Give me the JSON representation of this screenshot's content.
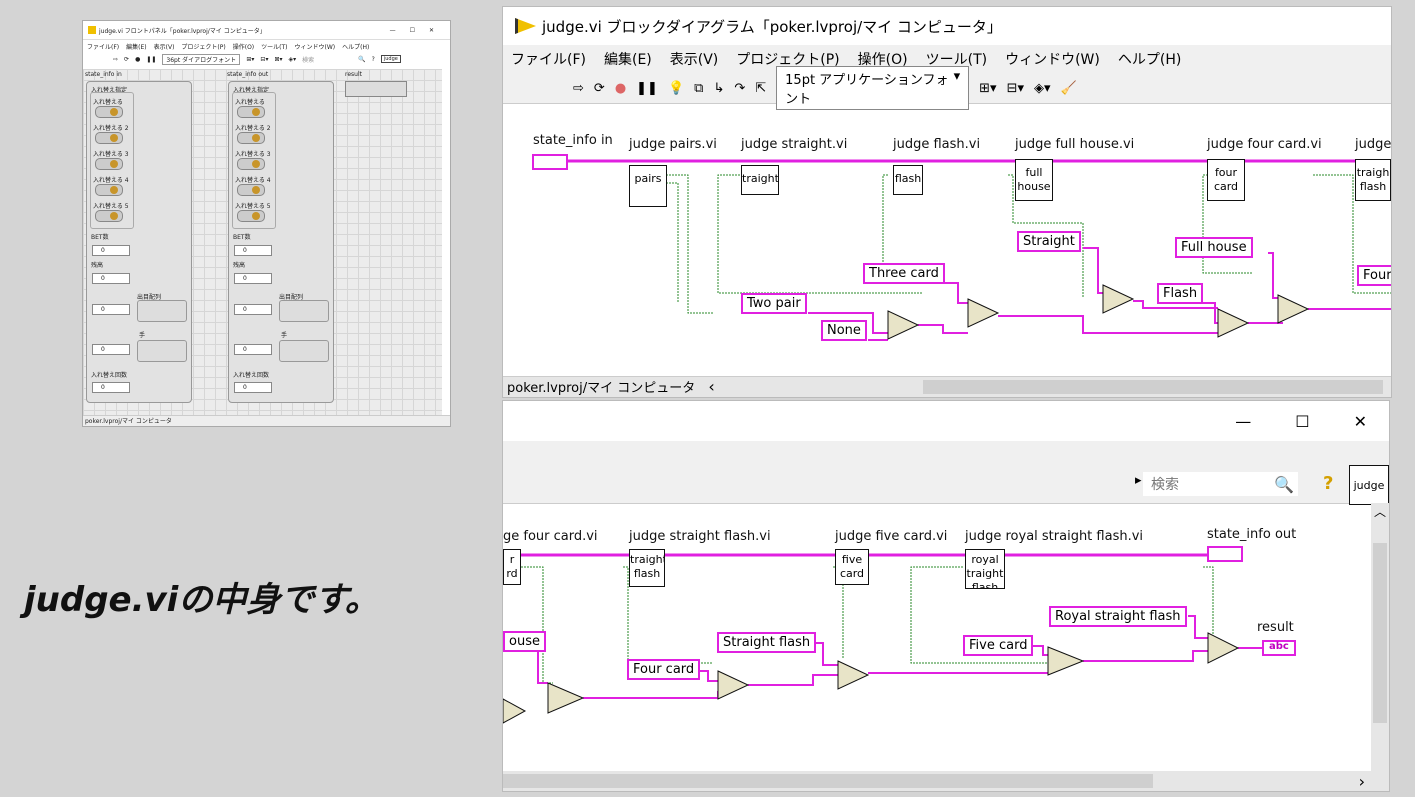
{
  "caption": "judge.viの中身です。",
  "front_panel": {
    "title": "judge.vi フロントパネル「poker.lvproj/マイ コンピュータ」",
    "menu": [
      "ファイル(F)",
      "編集(E)",
      "表示(V)",
      "プロジェクト(P)",
      "操作(O)",
      "ツール(T)",
      "ウィンドウ(W)",
      "ヘルプ(H)"
    ],
    "font": "36pt ダイアログフォント",
    "search_placeholder": "検索",
    "icon_label": "judge",
    "cluster_in": "state_info in",
    "cluster_out": "state_info out",
    "result_label": "result",
    "swap_spec": "入れ替え指定",
    "toggles": [
      "入れ替える",
      "入れ替える 2",
      "入れ替える 3",
      "入れ替える 4",
      "入れ替える 5"
    ],
    "bet_label": "BET数",
    "balance_label": "残高",
    "deck_label": "出目配列",
    "hand_label": "手",
    "swap_count_label": "入れ替え回数",
    "zero": "0",
    "footer": "poker.lvproj/マイ コンピュータ"
  },
  "bd_top": {
    "title": "judge.vi ブロックダイアグラム「poker.lvproj/マイ コンピュータ」",
    "menu": [
      "ファイル(F)",
      "編集(E)",
      "表示(V)",
      "プロジェクト(P)",
      "操作(O)",
      "ツール(T)",
      "ウィンドウ(W)",
      "ヘルプ(H)"
    ],
    "font": "15pt アプリケーションフォント",
    "terminal_in": "state_info in",
    "subvis": [
      {
        "label": "judge pairs.vi",
        "icon": "pairs"
      },
      {
        "label": "judge straight.vi",
        "icon": "traight"
      },
      {
        "label": "judge flash.vi",
        "icon": "flash"
      },
      {
        "label": "judge full house.vi",
        "icon": "full house"
      },
      {
        "label": "judge four card.vi",
        "icon": "four card"
      },
      {
        "label": "judge",
        "icon": "traigh flash"
      }
    ],
    "constants": [
      "Two pair",
      "None",
      "Three card",
      "Straight",
      "Flash",
      "Full house",
      "Four"
    ],
    "footer": "poker.lvproj/マイ コンピュータ"
  },
  "bd_bottom": {
    "search_placeholder": "検索",
    "icon_label": "judge",
    "subvis": [
      {
        "label": "ge four card.vi",
        "icon": "r rd"
      },
      {
        "label": "judge straight flash.vi",
        "icon": "traight flash"
      },
      {
        "label": "judge five card.vi",
        "icon": "five card"
      },
      {
        "label": "judge royal straight flash.vi",
        "icon": "royal traight flash"
      }
    ],
    "terminal_out": "state_info out",
    "result": "result",
    "constants": [
      "ouse",
      "Straight flash",
      "Four card",
      "Five card",
      "Royal straight flash"
    ],
    "abc": "abc"
  },
  "colors": {
    "wire_pink": "#e020e0",
    "wire_green": "#2a8a2a",
    "select_fill": "#e8e4c8"
  }
}
